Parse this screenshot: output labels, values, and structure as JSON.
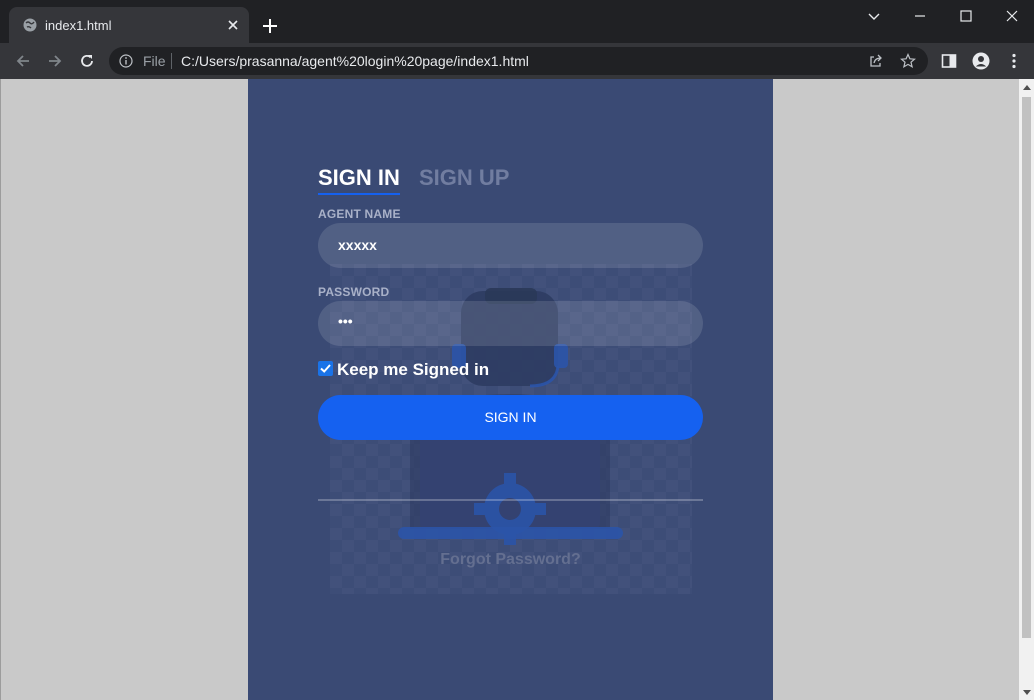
{
  "browser": {
    "tab_title": "index1.html",
    "omnibox": {
      "scheme_label": "File",
      "url": "C:/Users/prasanna/agent%20login%20page/index1.html"
    }
  },
  "login": {
    "tabs": {
      "signin": "SIGN IN",
      "signup": "SIGN UP"
    },
    "agent_name": {
      "label": "AGENT NAME",
      "value": "xxxxx"
    },
    "password": {
      "label": "PASSWORD",
      "value": "•••"
    },
    "keep_signed_in": {
      "label": "Keep me Signed in",
      "checked": true
    },
    "submit_label": "SIGN IN",
    "forgot_label": "Forgot Password?"
  },
  "colors": {
    "panel": "#3a4a74",
    "accent": "#1561f0",
    "page_bg": "#c9c9c9"
  }
}
